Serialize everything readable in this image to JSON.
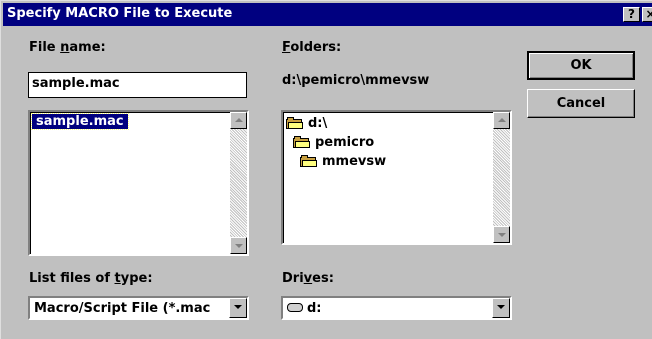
{
  "window": {
    "title": "Specify MACRO File to Execute",
    "help_button": "?",
    "close_button": "×"
  },
  "file_name": {
    "label_pre": "File ",
    "label_key": "n",
    "label_post": "ame:",
    "value": "sample.mac",
    "list_items": [
      "sample.mac"
    ]
  },
  "folders": {
    "label_key": "F",
    "label_post": "olders:",
    "current_path": "d:\\pemicro\\mmevsw",
    "tree": [
      "d:\\",
      "pemicro",
      "mmevsw"
    ]
  },
  "file_type": {
    "label_pre": "List files of ",
    "label_key": "t",
    "label_post": "ype:",
    "selected": "Macro/Script File (*.mac"
  },
  "drives": {
    "label_pre": "Dri",
    "label_key": "v",
    "label_post": "es:",
    "selected": "d:"
  },
  "buttons": {
    "ok": "OK",
    "cancel": "Cancel"
  },
  "colors": {
    "face": "#c0c0c0",
    "title_bar": "#000080",
    "selection": "#000080"
  }
}
